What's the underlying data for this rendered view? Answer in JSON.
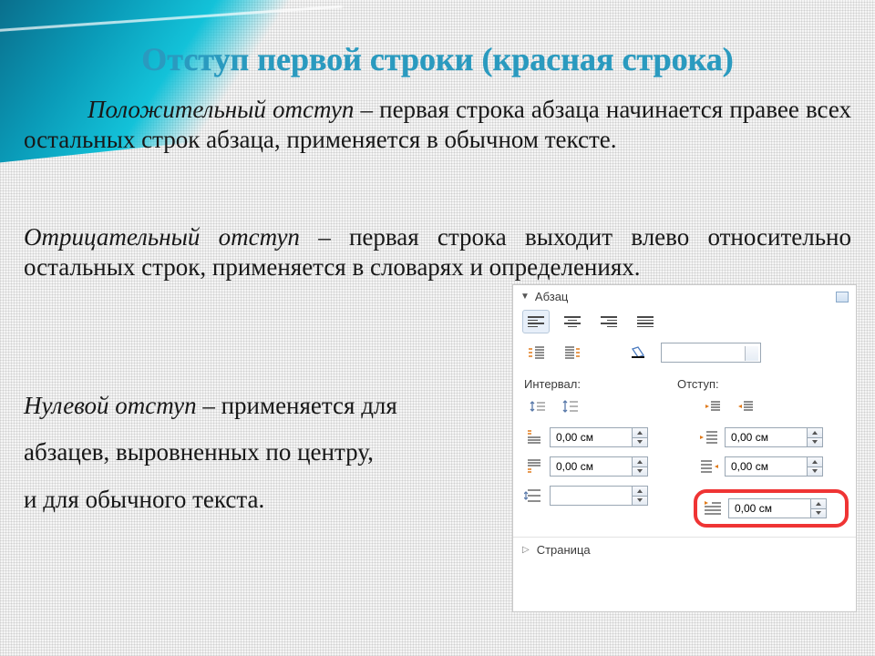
{
  "title": "Отступ первой строки (красная строка)",
  "paragraphs": {
    "p1_em": "Положительный отступ",
    "p1_rest": " – первая строка абзаца начинается правее всех остальных строк абзаца, применяется в обычном тексте.",
    "p2_em": "Отрицательный отступ",
    "p2_rest": " – первая строка выходит влево относительно остальных строк, применяется в словарях и определениях.",
    "p3_em": "Нулевой отступ",
    "p3_rest_a": " – применяется для",
    "p3_line2": "абзацев, выровненных по центру,",
    "p3_line3": "и для обычного текста."
  },
  "panel": {
    "section_paragraph": "Абзац",
    "label_interval": "Интервал:",
    "label_indent": "Отступ:",
    "section_page": "Страница",
    "values": {
      "space_before": "0,00 см",
      "space_after": "0,00 см",
      "line_spacing": "",
      "indent_before": "0,00 см",
      "indent_after": "0,00 см",
      "first_line": "0,00 см"
    }
  }
}
